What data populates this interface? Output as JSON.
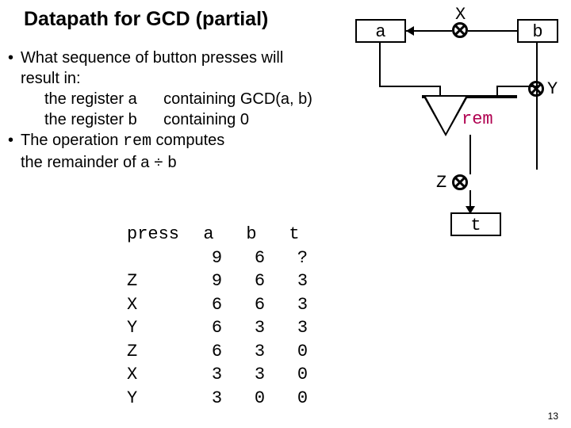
{
  "title": "Datapath for GCD (partial)",
  "bullets": {
    "b1a": "What sequence of button presses will",
    "b1b": "result in:",
    "b1c_pre": "the register a",
    "b1c_post": "containing GCD(a, b)",
    "b1d_pre": "the register b",
    "b1d_post": "containing 0",
    "b2a_pre": "The operation ",
    "b2a_code": "rem",
    "b2a_post": " computes",
    "b2b_pre": "the remainder of a",
    "b2b_div": "÷",
    "b2b_post": "b"
  },
  "table": {
    "headers": [
      "press",
      "a",
      "b",
      "t"
    ],
    "rows": [
      [
        "",
        "9",
        "6",
        "?"
      ],
      [
        "Z",
        "9",
        "6",
        "3"
      ],
      [
        "X",
        "6",
        "6",
        "3"
      ],
      [
        "Y",
        "6",
        "3",
        "3"
      ],
      [
        "Z",
        "6",
        "3",
        "0"
      ],
      [
        "X",
        "3",
        "3",
        "0"
      ],
      [
        "Y",
        "3",
        "0",
        "0"
      ]
    ]
  },
  "diagram": {
    "a": "a",
    "b": "b",
    "t": "t",
    "rem": "rem",
    "x": "X",
    "y": "Y",
    "z": "Z"
  },
  "page": "13"
}
